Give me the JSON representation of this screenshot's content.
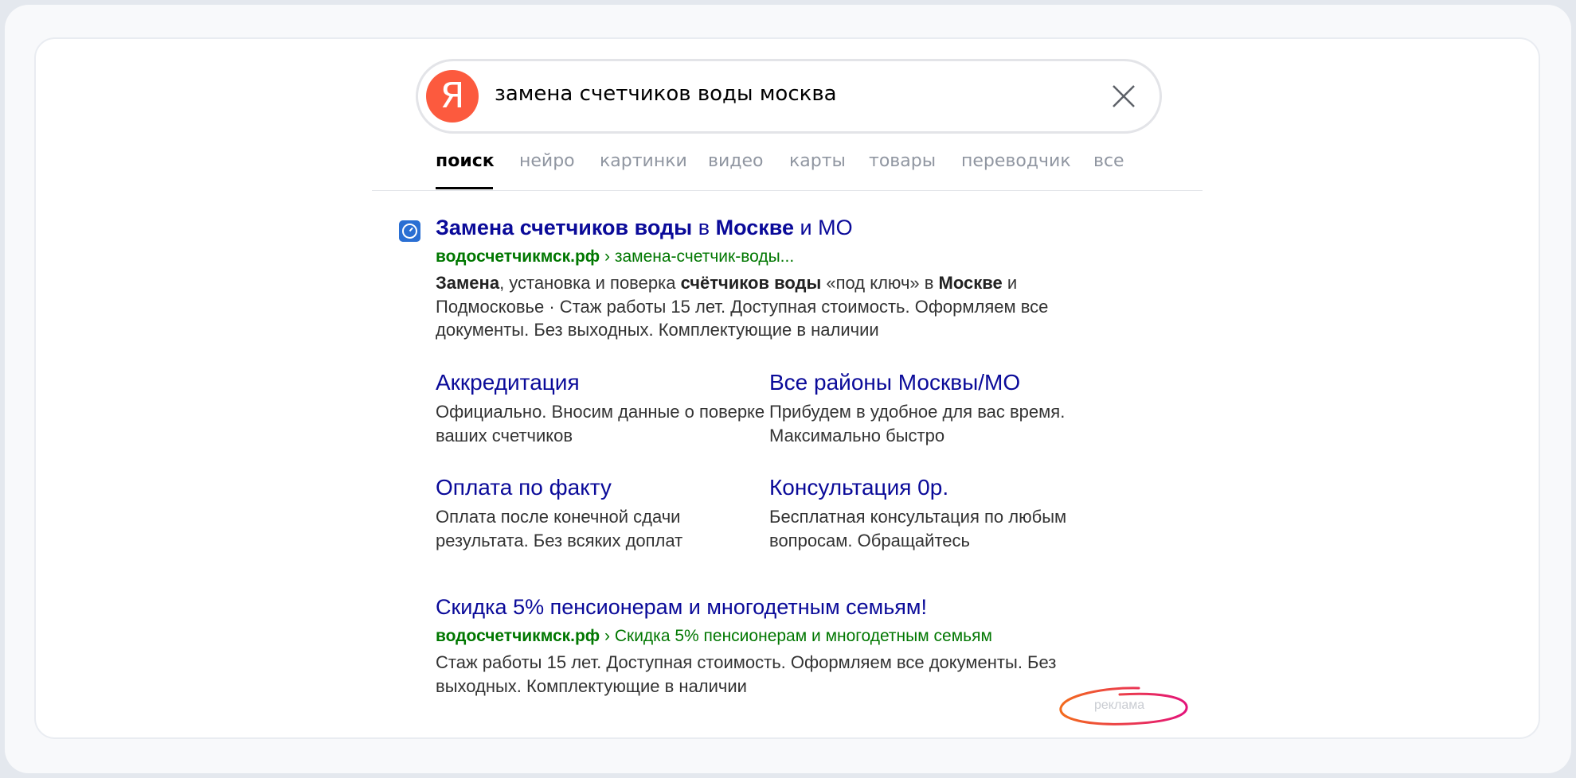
{
  "search": {
    "logo_letter": "Я",
    "query": "замена счетчиков воды москва"
  },
  "tabs": [
    {
      "label": "поиск",
      "active": true
    },
    {
      "label": "нейро",
      "active": false
    },
    {
      "label": "картинки",
      "active": false
    },
    {
      "label": "видео",
      "active": false
    },
    {
      "label": "карты",
      "active": false
    },
    {
      "label": "товары",
      "active": false
    },
    {
      "label": "переводчик",
      "active": false
    },
    {
      "label": "все",
      "active": false
    }
  ],
  "result": {
    "title_parts": [
      "Замена счетчиков воды",
      " в ",
      "Москве",
      " и МО"
    ],
    "url_domain": "водосчетчикмск.рф",
    "url_path": " › замена-счетчик-воды...",
    "snippet_parts": [
      "Замена",
      ", установка и поверка ",
      "счётчиков воды",
      " «под ключ» в ",
      "Москве",
      " и Подмосковье · Стаж работы 15 лет. Доступная стоимость. Оформляем все документы. Без выходных. Комплектующие в наличии"
    ],
    "sitelinks": [
      {
        "title": "Аккредитация",
        "text": "Официально. Вносим данные о поверке ваших счетчиков"
      },
      {
        "title": "Все районы Москвы/МО",
        "text": "Прибудем в удобное для вас время. Максимально быстро"
      },
      {
        "title": "Оплата по факту",
        "text": "Оплата после конечной сдачи результата. Без всяких доплат"
      },
      {
        "title": "Консультация 0р.",
        "text": "Бесплатная консультация по любым вопросам. Обращайтесь"
      }
    ],
    "promo": {
      "title": "Скидка 5% пенсионерам и многодетным семьям!",
      "url_domain": "водосчетчикмск.рф",
      "url_path": " › Скидка 5% пенсионерам и многодетным семьям",
      "snippet": "Стаж работы 15 лет. Доступная стоимость. Оформляем все документы. Без выходных. Комплектующие в наличии"
    },
    "ad_label": "реклама"
  },
  "colors": {
    "logo": "#fc5a3e",
    "link": "#0a0a99",
    "url": "#007700",
    "ad_circle_start": "#f36b1c",
    "ad_circle_end": "#e3127a"
  }
}
